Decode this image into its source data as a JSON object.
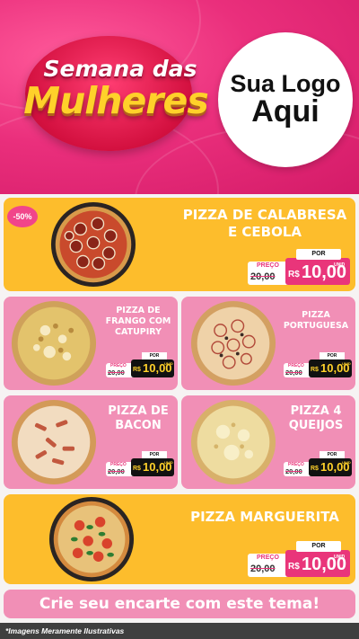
{
  "header": {
    "brand_line1": "Semana das",
    "brand_line2": "Mulheres",
    "logo_line1": "Sua Logo",
    "logo_line2": "Aqui"
  },
  "discount_badge": "-50%",
  "products": [
    {
      "name_l1": "PIZZA DE CALABRESA",
      "name_l2": "E CEBOLA",
      "preco_label": "PREÇO",
      "old_price": "20,00",
      "por_label": "POR",
      "currency": "R$",
      "price": "10,00",
      "unit": "UNID"
    },
    {
      "name_l1": "PIZZA DE",
      "name_l2": "FRANGO COM",
      "name_l3": "CATUPIRY",
      "preco_label": "PREÇO",
      "old_price": "20,00",
      "por_label": "POR",
      "currency": "R$",
      "price": "10,00",
      "unit": "UNID"
    },
    {
      "name_l1": "PIZZA",
      "name_l2": "PORTUGUESA",
      "preco_label": "PREÇO",
      "old_price": "20,00",
      "por_label": "POR",
      "currency": "R$",
      "price": "10,00",
      "unit": "UNID"
    },
    {
      "name_l1": "PIZZA DE",
      "name_l2": "BACON",
      "preco_label": "PREÇO",
      "old_price": "20,00",
      "por_label": "POR",
      "currency": "R$",
      "price": "10,00",
      "unit": "UNID"
    },
    {
      "name_l1": "PIZZA 4",
      "name_l2": "QUEIJOS",
      "preco_label": "PREÇO",
      "old_price": "20,00",
      "por_label": "POR",
      "currency": "R$",
      "price": "10,00",
      "unit": "UNID"
    },
    {
      "name_l1": "PIZZA MARGUERITA",
      "preco_label": "PREÇO",
      "old_price": "20,00",
      "por_label": "POR",
      "currency": "R$",
      "price": "10,00",
      "unit": "UNID"
    }
  ],
  "cta": "Crie seu encarte com este tema!",
  "footer": "*Imagens Meramente Ilustrativas",
  "colors": {
    "header_pink": "#ea2f7c",
    "card_yellow": "#fdbd2c",
    "card_pink": "#f18fb6",
    "accent_magenta": "#e9357a",
    "brand_gold": "#ffd12a"
  },
  "icons": [
    "pizza-image"
  ]
}
